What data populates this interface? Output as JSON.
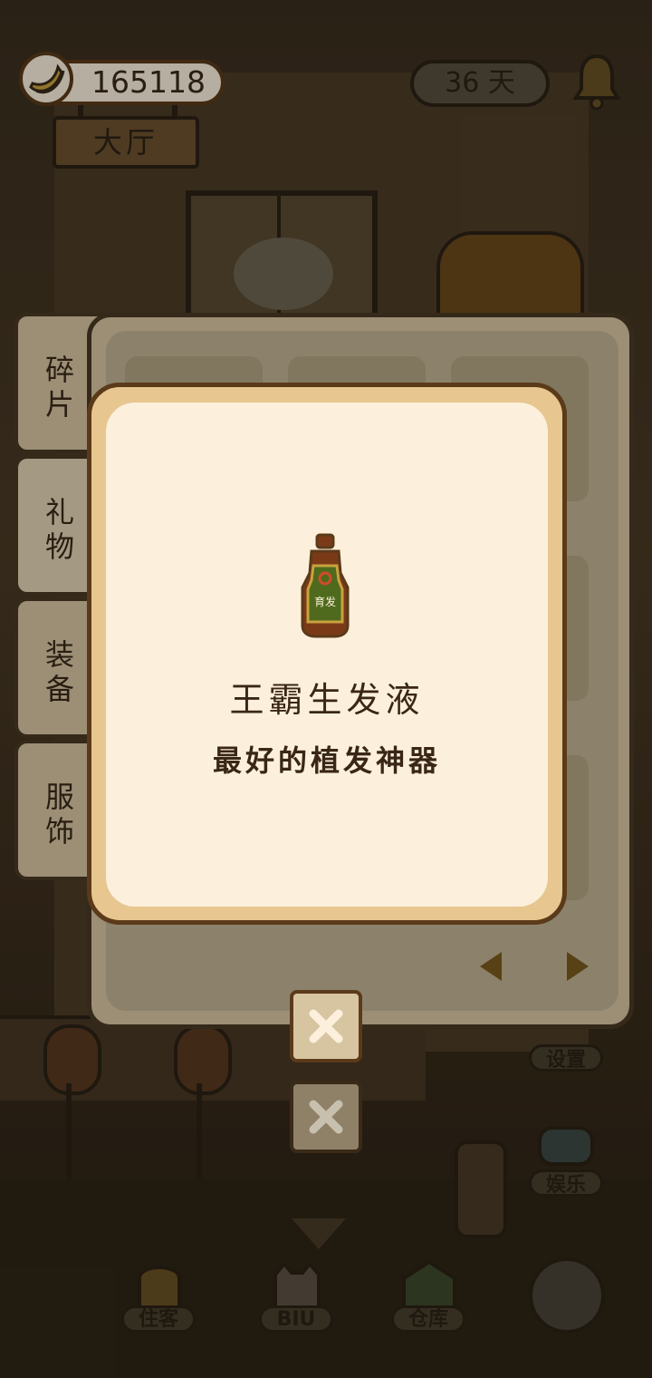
{
  "hud": {
    "banana_count": "165118",
    "location_label": "大厅",
    "days_label": "36 天"
  },
  "tabs": [
    {
      "label": "碎片"
    },
    {
      "label": "礼物"
    },
    {
      "label": "装备"
    },
    {
      "label": "服饰"
    }
  ],
  "dialog": {
    "item_name": "王霸生发液",
    "item_desc": "最好的植发神器"
  },
  "side_buttons": {
    "settings_label": "设置",
    "entertainment_label": "娱乐"
  },
  "bottom_nav": {
    "guests_label": "住客",
    "biu_label": "BIU",
    "warehouse_label": "仓库"
  },
  "colors": {
    "accent_brown": "#5b3a1a",
    "dialog_fill": "#fcf0dc",
    "dialog_border": "#e7c690",
    "arrow_color": "#7a5c1e"
  }
}
